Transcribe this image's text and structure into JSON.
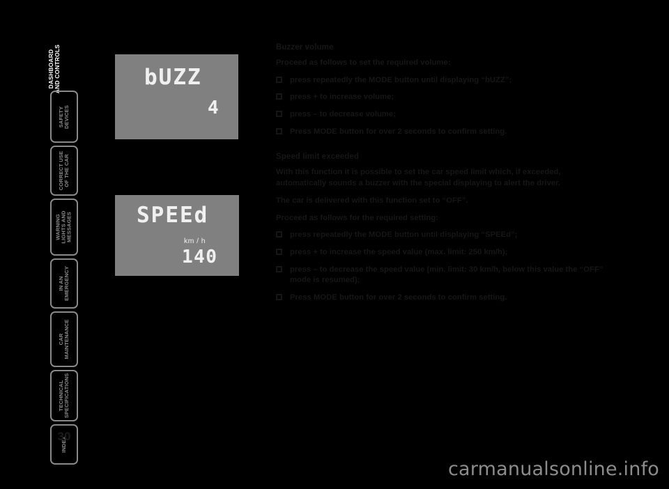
{
  "sidebar": {
    "chapter_title_lines": [
      "DASHBOARD",
      "AND CONTROLS"
    ],
    "tabs": [
      {
        "lines": [
          "SAFETY",
          "DEVICES"
        ]
      },
      {
        "lines": [
          "CORRECT USE",
          "OF THE CAR"
        ]
      },
      {
        "lines": [
          "WARNING",
          "LIGHTS AND",
          "MESSAGES"
        ]
      },
      {
        "lines": [
          "IN AN",
          "EMERGENCY"
        ]
      },
      {
        "lines": [
          "CAR",
          "MAINTENANCE"
        ]
      },
      {
        "lines": [
          "TECHNICAL",
          "SPECIFICATIONS"
        ]
      },
      {
        "lines": [
          "INDEX"
        ]
      }
    ],
    "page_number": "30"
  },
  "displays": {
    "buzzer": {
      "label": "bUZZ",
      "value": "4"
    },
    "speed": {
      "label": "SPEEd",
      "unit": "km / h",
      "value": "140"
    }
  },
  "content": {
    "section1": {
      "heading": "Buzzer volume",
      "intro": "Proceed as follows to set the required volume:",
      "bullets": [
        "press repeatedly the MODE button until displaying “bUZZ”;",
        "press + to increase volume;",
        "press – to decrease volume;",
        "Press MODE button for over 2 seconds to confirm setting."
      ]
    },
    "section2": {
      "heading": "Speed limit exceeded",
      "paragraph1": "With this function it is possible to set the car speed limit which, if exceeded, automatically sounds a buzzer with the special displaying to alert the driver.",
      "paragraph2": "The car is delivered with this function set to “OFF”.",
      "intro": "Proceed as follows for the required setting:",
      "bullets": [
        "press repeatedly the MODE button until displaying “SPEEd”;",
        "press + to increase the speed value (max. limit: 250 km/h);",
        "press – to decrease the speed value (min. limit: 30 km/h, below this value the “OFF” mode is resumed);",
        "Press MODE button for over 2 seconds to confirm setting."
      ]
    }
  },
  "watermark": "carmanualsonline.info"
}
